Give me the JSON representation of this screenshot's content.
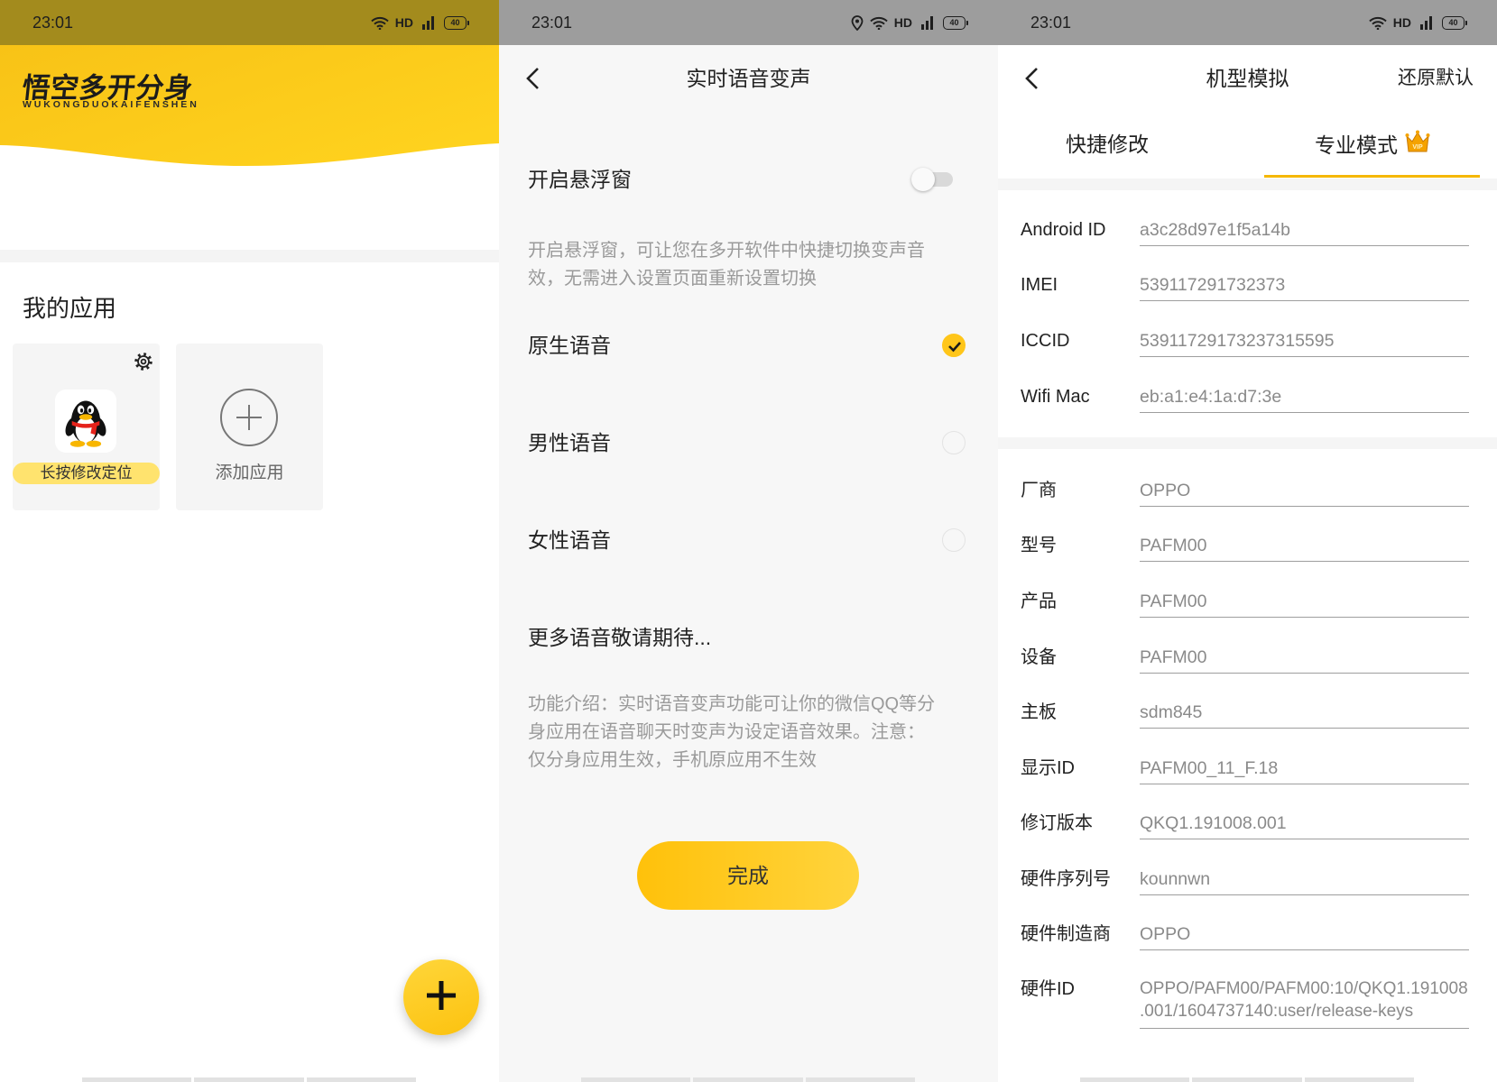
{
  "status_bar": {
    "time": "23:01",
    "network_label": "HD",
    "battery_level": "40",
    "icons": [
      "location-icon",
      "wifi-icon",
      "signal-icon",
      "battery-icon"
    ]
  },
  "panel_home": {
    "logo_title": "悟空多开分身",
    "logo_subtitle": "WUKONGDUOKAIFENSHEN",
    "section_title": "我的应用",
    "apps": [
      {
        "icon": "qq-penguin-icon",
        "settings_icon": "gear-icon",
        "label": "长按修改定位"
      }
    ],
    "add_app": {
      "icon": "plus-circle-icon",
      "label": "添加应用"
    },
    "fab_icon": "plus-icon"
  },
  "panel_voice": {
    "title": "实时语音变声",
    "floating_window": {
      "label": "开启悬浮窗",
      "enabled": false,
      "description": "开启悬浮窗，可让您在多开软件中快捷切换变声音效，无需进入设置页面重新设置切换"
    },
    "voices": [
      {
        "label": "原生语音",
        "selected": true
      },
      {
        "label": "男性语音",
        "selected": false
      },
      {
        "label": "女性语音",
        "selected": false
      }
    ],
    "more_voices": "更多语音敬请期待...",
    "intro": "功能介绍：实时语音变声功能可让你的微信QQ等分身应用在语音聊天时变声为设定语音效果。注意：仅分身应用生效，手机原应用不生效",
    "done_label": "完成"
  },
  "panel_device": {
    "title": "机型模拟",
    "reset_label": "还原默认",
    "tabs": [
      {
        "label": "快捷修改",
        "active": false
      },
      {
        "label": "专业模式",
        "active": true,
        "badge_icon": "vip-crown-icon",
        "badge_text": "VIP"
      }
    ],
    "identity_fields": [
      {
        "label": "Android ID",
        "value": "a3c28d97e1f5a14b"
      },
      {
        "label": "IMEI",
        "value": "539117291732373"
      },
      {
        "label": "ICCID",
        "value": "53911729173237315595"
      },
      {
        "label": "Wifi Mac",
        "value": "eb:a1:e4:1a:d7:3e"
      }
    ],
    "device_fields": [
      {
        "label": "厂商",
        "value": "OPPO"
      },
      {
        "label": "型号",
        "value": "PAFM00"
      },
      {
        "label": "产品",
        "value": "PAFM00"
      },
      {
        "label": "设备",
        "value": "PAFM00"
      },
      {
        "label": "主板",
        "value": "sdm845"
      },
      {
        "label": "显示ID",
        "value": "PAFM00_11_F.18"
      },
      {
        "label": "修订版本",
        "value": "QKQ1.191008.001"
      },
      {
        "label": "硬件序列号",
        "value": "kounnwn"
      },
      {
        "label": "硬件制造商",
        "value": "OPPO"
      },
      {
        "label": "硬件ID",
        "value": "OPPO/PAFM00/PAFM00:10/QKQ1.191008.001/1604737140:user/release-keys"
      }
    ]
  },
  "colors": {
    "accent": "#ffc61a",
    "accent_light": "#ffe36e",
    "tab_underline": "#f5b700",
    "status_bar_home": "#a38b1d",
    "status_bar_gray": "#9d9d9d",
    "text_primary": "#222222",
    "text_secondary": "#8a8a8a"
  }
}
